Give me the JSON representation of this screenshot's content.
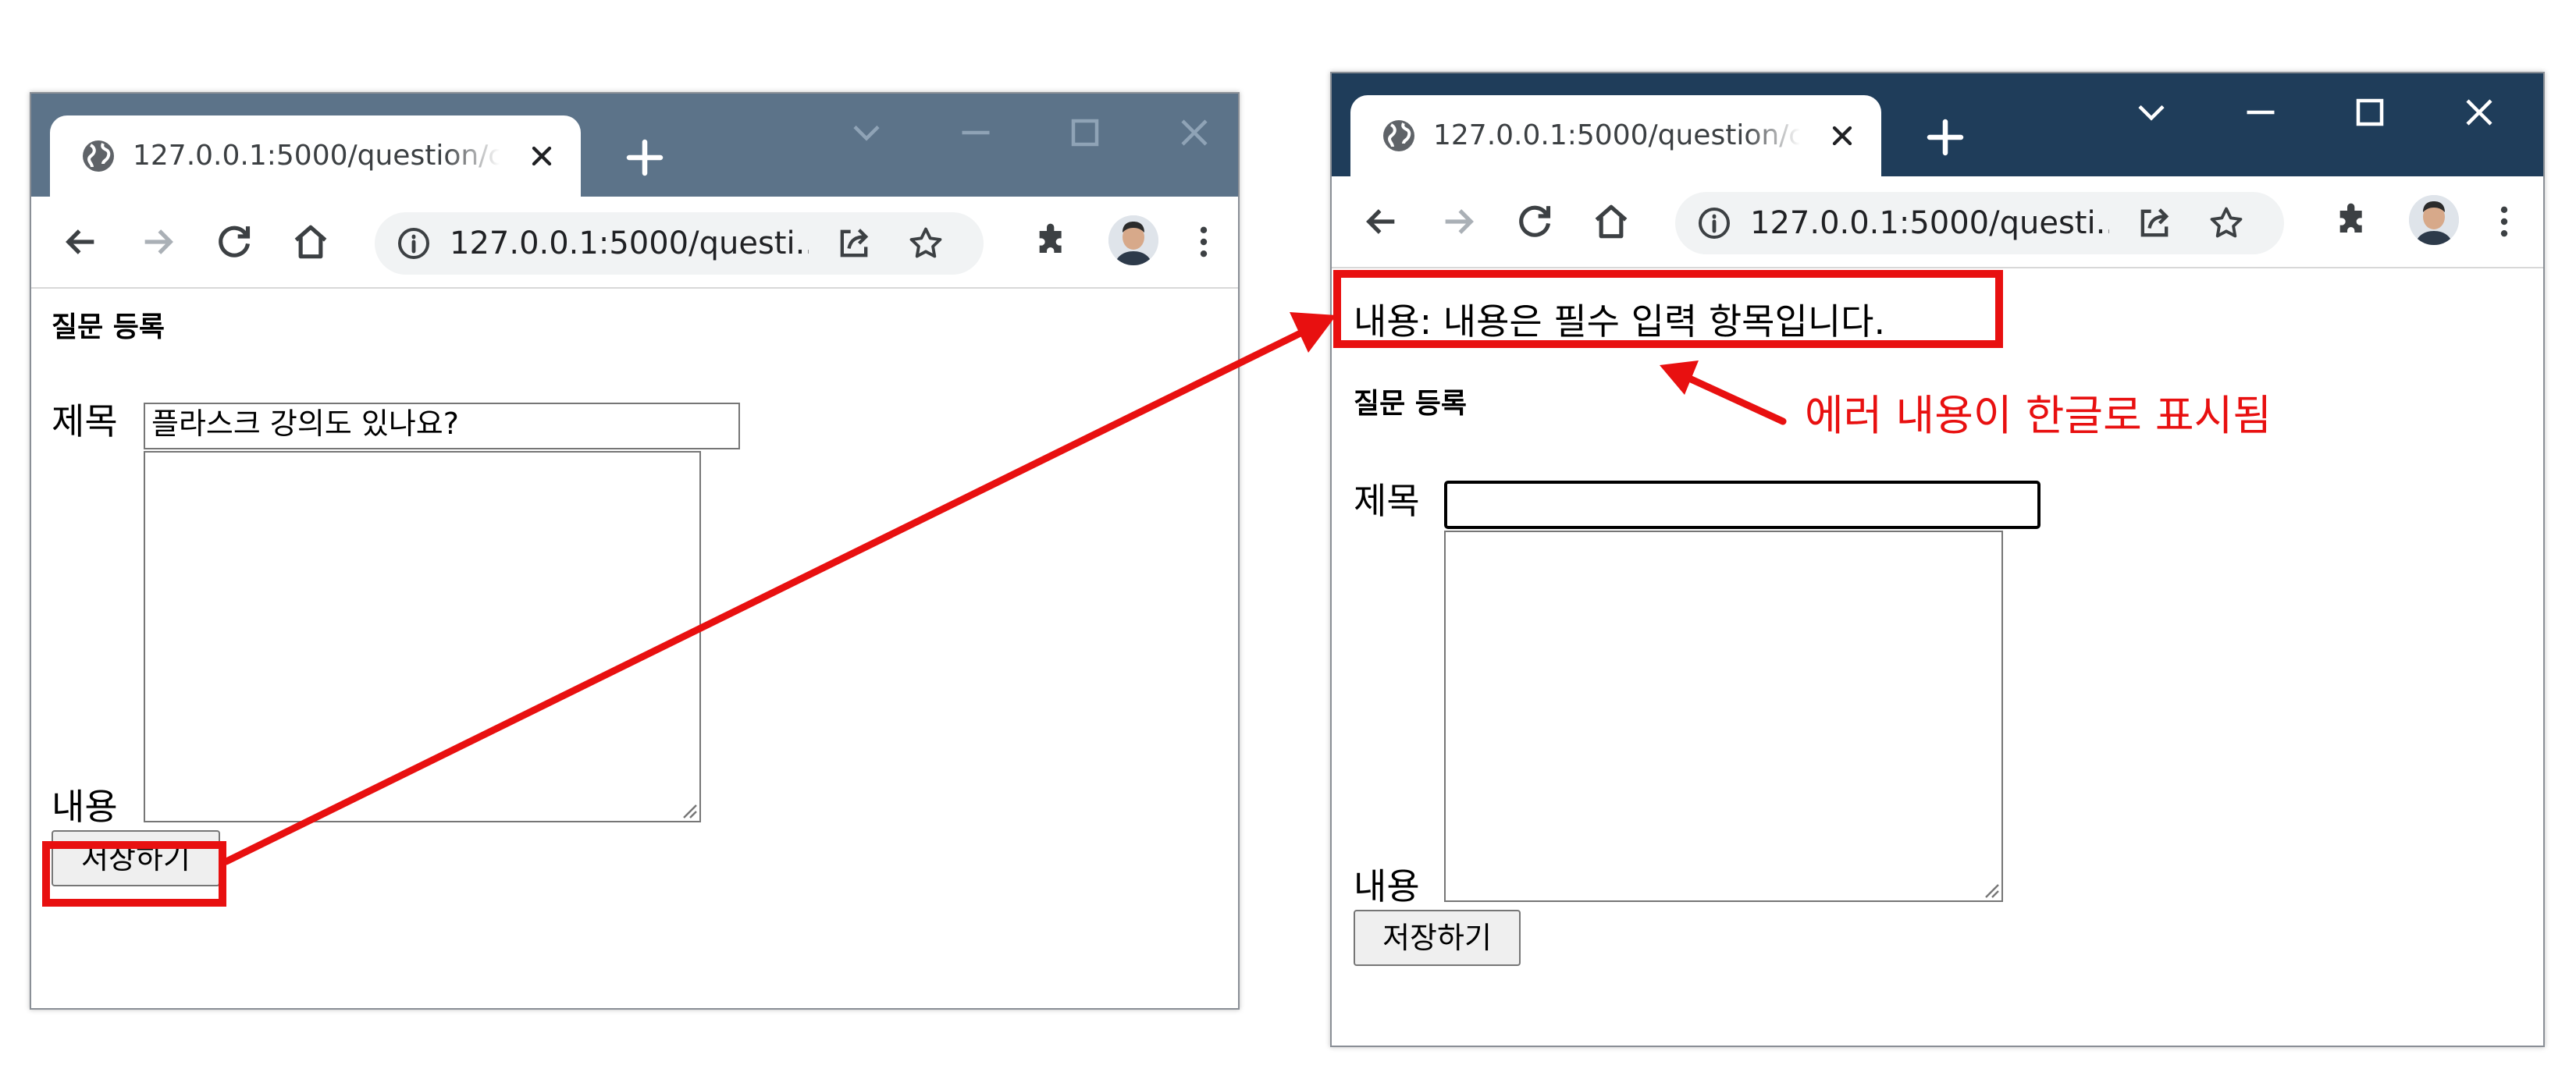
{
  "left_window": {
    "tab_title": "127.0.0.1:5000/question/create",
    "url": "127.0.0.1:5000/questi...",
    "page_title": "질문 등록",
    "subject_label": "제목",
    "subject_value": "플라스크 강의도 있나요?",
    "content_label": "내용",
    "save_label": "저장하기"
  },
  "right_window": {
    "tab_title": "127.0.0.1:5000/question/create",
    "url": "127.0.0.1:5000/questi...",
    "error_message": "내용: 내용은 필수 입력 항목입니다.",
    "page_title": "질문 등록",
    "subject_label": "제목",
    "subject_value": "",
    "content_label": "내용",
    "save_label": "저장하기"
  },
  "annotation": {
    "text": "에러 내용이 한글로 표시됨",
    "color": "#e81010"
  },
  "colors": {
    "left_titlebar": "#5c7389",
    "right_titlebar": "#1f3d5a"
  }
}
